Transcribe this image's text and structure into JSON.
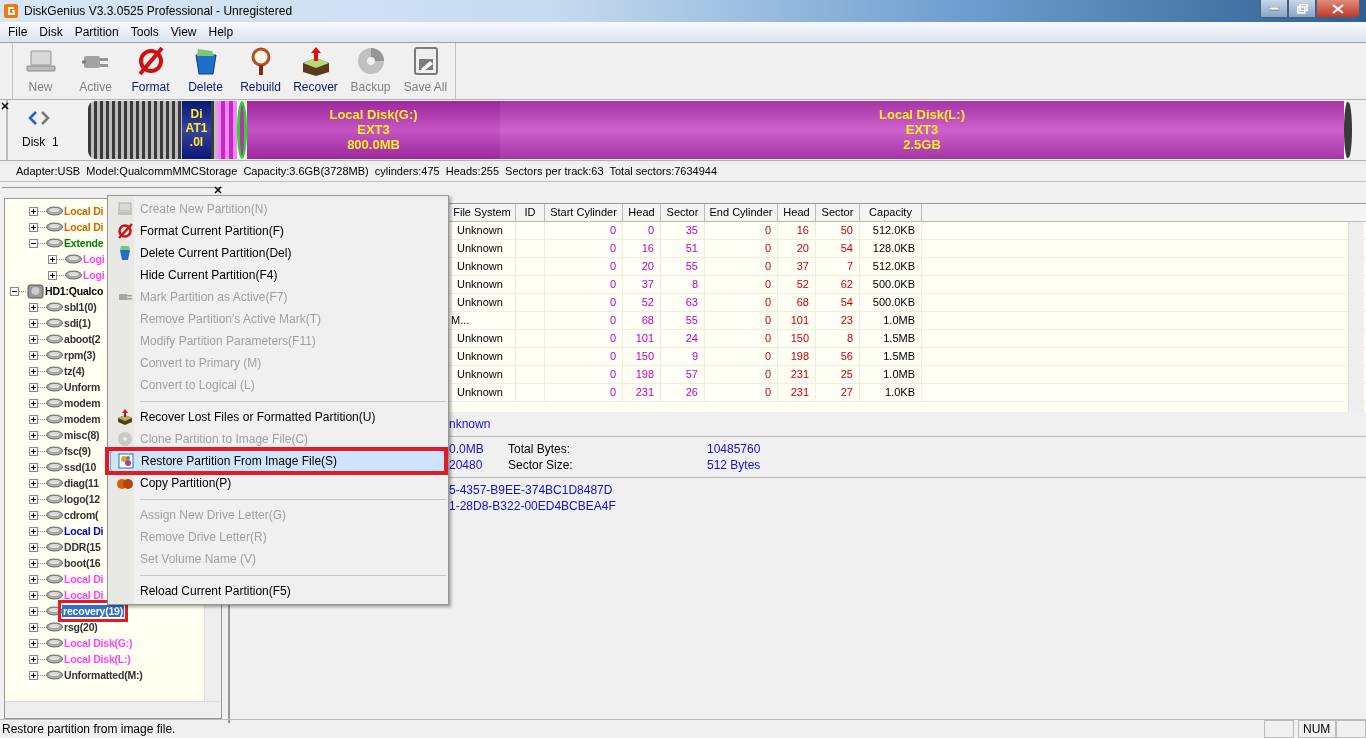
{
  "window": {
    "title": "DiskGenius V3.3.0525 Professional - Unregistered"
  },
  "menu": [
    "File",
    "Disk",
    "Partition",
    "Tools",
    "View",
    "Help"
  ],
  "toolbar": [
    {
      "label": "New",
      "disabled": true
    },
    {
      "label": "Active",
      "disabled": true
    },
    {
      "label": "Format",
      "disabled": false
    },
    {
      "label": "Delete",
      "disabled": false
    },
    {
      "label": "Rebuild",
      "disabled": false
    },
    {
      "label": "Recover",
      "disabled": false
    },
    {
      "label": "Backup",
      "disabled": true
    },
    {
      "label": "Save All",
      "disabled": true
    }
  ],
  "disk_bar": {
    "label": "Disk  1",
    "partitions": [
      {
        "lines": [
          "Di",
          "AT1",
          ".0l"
        ],
        "color": "#0c1a8a"
      },
      {
        "lines": [
          "Local Disk(G:)",
          "EXT3",
          "800.0MB"
        ],
        "color": "#b82fb8"
      },
      {
        "lines": [
          "Local Disk(L:)",
          "EXT3",
          "2.5GB"
        ],
        "color": "#c23ec2"
      }
    ]
  },
  "disk_info": "Adapter:USB  Model:QualcommMMCStorage  Capacity:3.6GB(3728MB)  cylinders:475  Heads:255  Sectors per track:63  Total sectors:7634944",
  "tree": {
    "items": [
      {
        "children": [
          {
            "label": "Local Di",
            "color": "#cc6600",
            "expanded": false,
            "selected": false
          },
          {
            "label": "Local Di",
            "color": "#cc6600",
            "expanded": false,
            "selected": false
          },
          {
            "label": "Extende",
            "color": "#008000",
            "expanded": true,
            "selected": false,
            "children": [
              {
                "label": "Logi",
                "color": "#ff40ff",
                "expanded": false,
                "selected": false
              },
              {
                "label": "Logi",
                "color": "#ff40ff",
                "expanded": false,
                "selected": false
              }
            ]
          }
        ]
      },
      {
        "label": "HD1:Qualco",
        "kind": "disk",
        "color": "#000000",
        "expanded": true,
        "selected": false,
        "children": [
          {
            "label": "sbl1(0)",
            "color": "#333333",
            "expanded": false,
            "selected": false
          },
          {
            "label": "sdi(1)",
            "color": "#333333",
            "expanded": false,
            "selected": false
          },
          {
            "label": "aboot(2",
            "color": "#333333",
            "expanded": false,
            "selected": false
          },
          {
            "label": "rpm(3)",
            "color": "#333333",
            "expanded": false,
            "selected": false
          },
          {
            "label": "tz(4)",
            "color": "#333333",
            "expanded": false,
            "selected": false
          },
          {
            "label": "Unform",
            "color": "#333333",
            "expanded": false,
            "selected": false
          },
          {
            "label": "modem",
            "color": "#333333",
            "expanded": false,
            "selected": false
          },
          {
            "label": "modem",
            "color": "#333333",
            "expanded": false,
            "selected": false
          },
          {
            "label": "misc(8)",
            "color": "#333333",
            "expanded": false,
            "selected": false
          },
          {
            "label": "fsc(9)",
            "color": "#333333",
            "expanded": false,
            "selected": false
          },
          {
            "label": "ssd(10",
            "color": "#333333",
            "expanded": false,
            "selected": false
          },
          {
            "label": "diag(11",
            "color": "#333333",
            "expanded": false,
            "selected": false
          },
          {
            "label": "logo(12",
            "color": "#333333",
            "expanded": false,
            "selected": false
          },
          {
            "label": "cdrom(",
            "color": "#333333",
            "expanded": false,
            "selected": false
          },
          {
            "label": "Local Di",
            "color": "#0000cc",
            "expanded": false,
            "selected": false
          },
          {
            "label": "DDR(15",
            "color": "#333333",
            "expanded": false,
            "selected": false
          },
          {
            "label": "boot(16",
            "color": "#333333",
            "expanded": false,
            "selected": false
          },
          {
            "label": "Local Di",
            "color": "#ff40ff",
            "expanded": false,
            "selected": false
          },
          {
            "label": "Local Di",
            "color": "#ff40ff",
            "expanded": false,
            "selected": false
          },
          {
            "label": "recovery(19)",
            "expanded": false,
            "selected": true,
            "outlined": true
          },
          {
            "label": "rsg(20)",
            "color": "#333333",
            "expanded": false,
            "selected": false
          },
          {
            "label": "Local Disk(G:)",
            "color": "#ff40ff",
            "expanded": false,
            "selected": false
          },
          {
            "label": "Local Disk(L:)",
            "color": "#ff40ff",
            "expanded": false,
            "selected": false
          },
          {
            "label": "Unformatted(M:)",
            "color": "#333333",
            "expanded": false,
            "selected": false
          }
        ]
      }
    ]
  },
  "table": {
    "columns": [
      "File System",
      "ID",
      "Start Cylinder",
      "Head",
      "Sector",
      "End Cylinder",
      "Head",
      "Sector",
      "Capacity"
    ],
    "rows": [
      {
        "file_system": "Unknown",
        "start_cylinder": "0",
        "start_head": "0",
        "start_sector": "35",
        "end_cylinder": "0",
        "end_head": "16",
        "end_sector": "50",
        "capacity": "512.0KB"
      },
      {
        "file_system": "Unknown",
        "start_cylinder": "0",
        "start_head": "16",
        "start_sector": "51",
        "end_cylinder": "0",
        "end_head": "20",
        "end_sector": "54",
        "capacity": "128.0KB"
      },
      {
        "file_system": "Unknown",
        "start_cylinder": "0",
        "start_head": "20",
        "start_sector": "55",
        "end_cylinder": "0",
        "end_head": "37",
        "end_sector": "7",
        "capacity": "512.0KB"
      },
      {
        "file_system": "Unknown",
        "start_cylinder": "0",
        "start_head": "37",
        "start_sector": "8",
        "end_cylinder": "0",
        "end_head": "52",
        "end_sector": "62",
        "capacity": "500.0KB"
      },
      {
        "file_system": "Unknown",
        "start_cylinder": "0",
        "start_head": "52",
        "start_sector": "63",
        "end_cylinder": "0",
        "end_head": "68",
        "end_sector": "54",
        "capacity": "500.0KB"
      },
      {
        "file_system": "M...",
        "start_cylinder": "0",
        "start_head": "68",
        "start_sector": "55",
        "end_cylinder": "0",
        "end_head": "101",
        "end_sector": "23",
        "capacity": "1.0MB"
      },
      {
        "file_system": "Unknown",
        "start_cylinder": "0",
        "start_head": "101",
        "start_sector": "24",
        "end_cylinder": "0",
        "end_head": "150",
        "end_sector": "8",
        "capacity": "1.5MB"
      },
      {
        "file_system": "Unknown",
        "start_cylinder": "0",
        "start_head": "150",
        "start_sector": "9",
        "end_cylinder": "0",
        "end_head": "198",
        "end_sector": "56",
        "capacity": "1.5MB"
      },
      {
        "file_system": "Unknown",
        "start_cylinder": "0",
        "start_head": "198",
        "start_sector": "57",
        "end_cylinder": "0",
        "end_head": "231",
        "end_sector": "25",
        "capacity": "1.0MB"
      },
      {
        "file_system": "Unknown",
        "start_cylinder": "0",
        "start_head": "231",
        "start_sector": "26",
        "end_cylinder": "0",
        "end_head": "231",
        "end_sector": "27",
        "capacity": "1.0KB"
      }
    ]
  },
  "details": {
    "type_value": "nknown",
    "rows": [
      {
        "value": "0.0MB",
        "label": "Total Bytes:",
        "value_2": "10485760"
      },
      {
        "value": "20480",
        "label": "Sector Size:",
        "value_2": "512 Bytes"
      }
    ],
    "guids": [
      "5-4357-B9EE-374BC1D8487D",
      "1-28D8-B322-00ED4BCBEA4F"
    ]
  },
  "context_menu": {
    "items": [
      {
        "kind": "item",
        "label": "Create New Partition(N)",
        "disabled": true
      },
      {
        "kind": "item",
        "label": "Format Current Partition(F)",
        "disabled": false
      },
      {
        "kind": "item",
        "label": "Delete Current Partition(Del)",
        "disabled": false
      },
      {
        "kind": "item",
        "label": "Hide Current Partition(F4)",
        "disabled": false
      },
      {
        "kind": "item",
        "label": "Mark Partition as Active(F7)",
        "disabled": true
      },
      {
        "kind": "item",
        "label": "Remove Partition's Active Mark(T)",
        "disabled": true
      },
      {
        "kind": "item",
        "label": "Modify Partition Parameters(F11)",
        "disabled": true
      },
      {
        "kind": "item",
        "label": "Convert to Primary (M)",
        "disabled": true
      },
      {
        "kind": "item",
        "label": "Convert to Logical (L)",
        "disabled": true
      },
      {
        "kind": "separator"
      },
      {
        "kind": "item",
        "label": "Recover Lost Files or Formatted Partition(U)",
        "disabled": false
      },
      {
        "kind": "item",
        "label": "Clone Partition to Image File(C)",
        "disabled": true
      },
      {
        "kind": "item",
        "label": "Restore Partition From Image File(S)",
        "disabled": false,
        "selected": true,
        "outlined": true
      },
      {
        "kind": "item",
        "label": "Copy Partition(P)",
        "disabled": false
      },
      {
        "kind": "separator"
      },
      {
        "kind": "item",
        "label": "Assign New Drive Letter(G)",
        "disabled": true
      },
      {
        "kind": "item",
        "label": "Remove Drive Letter(R)",
        "disabled": true
      },
      {
        "kind": "item",
        "label": "Set Volume Name (V)",
        "disabled": true
      },
      {
        "kind": "separator"
      },
      {
        "kind": "item",
        "label": "Reload Current Partition(F5)",
        "disabled": false
      }
    ]
  },
  "status_bar": {
    "text": "Restore partition from image file.",
    "indicators": [
      "NUM"
    ]
  }
}
